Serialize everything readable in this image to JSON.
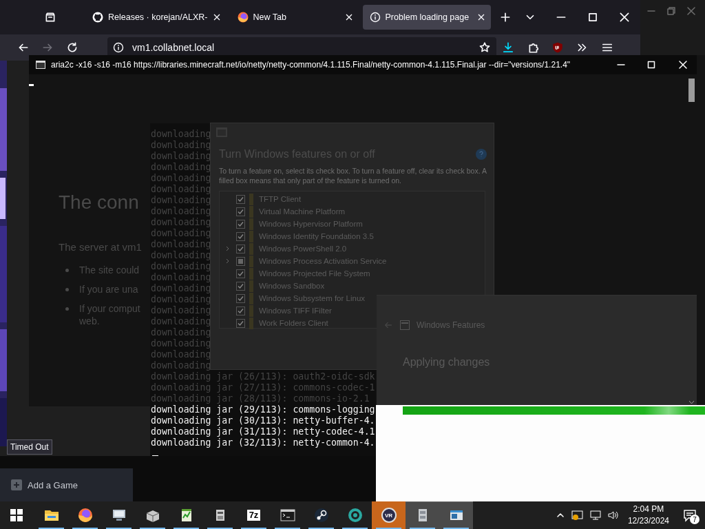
{
  "browser": {
    "tabs": [
      {
        "title": "Releases · korejan/ALXR-",
        "selected": false
      },
      {
        "title": "New Tab",
        "selected": false
      },
      {
        "title": "Problem loading page",
        "selected": true
      }
    ],
    "url": "vm1.collabnet.local",
    "status_tooltip": "Timed Out"
  },
  "console": {
    "title": "aria2c  -x16 -s16 -m16 https://libraries.minecraft.net/io/netty/netty-common/4.1.115.Final/netty-common-4.1.115.Final.jar --dir=\"versions/1.21.4\"",
    "error_page": {
      "heading": "The conn",
      "intro": "The server at vm1",
      "bullets": [
        [
          "The site could"
        ],
        [
          "If you are una"
        ],
        [
          "If your comput",
          "web."
        ]
      ]
    },
    "lines": [
      {
        "text": "downloading",
        "faint": true
      },
      {
        "text": "downloading",
        "faint": true
      },
      {
        "text": "downloading",
        "faint": true
      },
      {
        "text": "downloading",
        "faint": true
      },
      {
        "text": "downloading",
        "faint": true
      },
      {
        "text": "downloading",
        "faint": true
      },
      {
        "text": "downloading",
        "faint": true
      },
      {
        "text": "downloading",
        "faint": true
      },
      {
        "text": "downloading",
        "faint": true
      },
      {
        "text": "downloading",
        "faint": true
      },
      {
        "text": "downloading",
        "faint": true
      },
      {
        "text": "downloading",
        "faint": true
      },
      {
        "text": "downloading",
        "faint": true
      },
      {
        "text": "downloading",
        "faint": true
      },
      {
        "text": "downloading",
        "faint": true
      },
      {
        "text": "downloading",
        "faint": true
      },
      {
        "text": "downloading",
        "faint": true
      },
      {
        "text": "downloading",
        "faint": true
      },
      {
        "text": "downloading",
        "faint": true
      },
      {
        "text": "downloading",
        "faint": true
      },
      {
        "text": "downloading",
        "faint": true
      },
      {
        "text": "downloading",
        "faint": true
      },
      {
        "text": "downloading jar (26/113): oauth2-oidc-sdk",
        "faint": true
      },
      {
        "text": "downloading jar (27/113): commons-codec-1",
        "faint": true
      },
      {
        "text": "downloading jar (28/113): commons-io-2.1",
        "faint": true
      },
      {
        "text": "downloading jar (29/113): commons-logging",
        "faint": false
      },
      {
        "text": "downloading jar (30/113): netty-buffer-4.",
        "faint": false
      },
      {
        "text": "downloading jar (31/113): netty-codec-4.1",
        "faint": false
      },
      {
        "text": "downloading jar (32/113): netty-common-4.",
        "faint": false
      }
    ]
  },
  "features_dialog": {
    "heading": "Turn Windows features on or off",
    "description": "To turn a feature on, select its check box. To turn a feature off, clear its check box. A filled box means that only part of the feature is turned on.",
    "items": [
      {
        "label": "TFTP Client",
        "checked": true,
        "partial": false,
        "expandable": false
      },
      {
        "label": "Virtual Machine Platform",
        "checked": true,
        "partial": false,
        "expandable": false
      },
      {
        "label": "Windows Hypervisor Platform",
        "checked": true,
        "partial": false,
        "expandable": false
      },
      {
        "label": "Windows Identity Foundation 3.5",
        "checked": true,
        "partial": false,
        "expandable": false
      },
      {
        "label": "Windows PowerShell 2.0",
        "checked": true,
        "partial": false,
        "expandable": true
      },
      {
        "label": "Windows Process Activation Service",
        "checked": false,
        "partial": true,
        "expandable": true
      },
      {
        "label": "Windows Projected File System",
        "checked": true,
        "partial": false,
        "expandable": false
      },
      {
        "label": "Windows Sandbox",
        "checked": true,
        "partial": false,
        "expandable": false
      },
      {
        "label": "Windows Subsystem for Linux",
        "checked": true,
        "partial": false,
        "expandable": false
      },
      {
        "label": "Windows TIFF IFilter",
        "checked": true,
        "partial": false,
        "expandable": false
      },
      {
        "label": "Work Folders Client",
        "checked": true,
        "partial": false,
        "expandable": false
      }
    ]
  },
  "progress_dialog": {
    "title": "Windows Features",
    "status": "Applying changes"
  },
  "steam": {
    "add_game": "Add a Game"
  },
  "taskbar": {
    "apps": [
      {
        "kind": "folder",
        "running": true,
        "flashing": false,
        "selected": false
      },
      {
        "kind": "firefox",
        "running": true,
        "flashing": false,
        "selected": false
      },
      {
        "kind": "monitor",
        "running": true,
        "flashing": false,
        "selected": false
      },
      {
        "kind": "box",
        "running": true,
        "flashing": false,
        "selected": false
      },
      {
        "kind": "document",
        "running": true,
        "flashing": false,
        "selected": false
      },
      {
        "kind": "device",
        "running": true,
        "flashing": false,
        "selected": false
      },
      {
        "kind": "label",
        "label": "7z",
        "running": true,
        "flashing": false,
        "selected": false
      },
      {
        "kind": "terminal",
        "running": true,
        "flashing": false,
        "selected": false
      },
      {
        "kind": "steam",
        "running": true,
        "flashing": false,
        "selected": false
      },
      {
        "kind": "ring",
        "running": true,
        "flashing": false,
        "selected": false
      },
      {
        "kind": "vr",
        "label": "VR",
        "running": true,
        "flashing": true,
        "selected": false
      },
      {
        "kind": "cabinet",
        "running": true,
        "flashing": false,
        "selected": true
      },
      {
        "kind": "window",
        "running": true,
        "flashing": false,
        "selected": true
      }
    ],
    "time": "2:04 PM",
    "date": "12/23/2024",
    "notifications": "7"
  }
}
